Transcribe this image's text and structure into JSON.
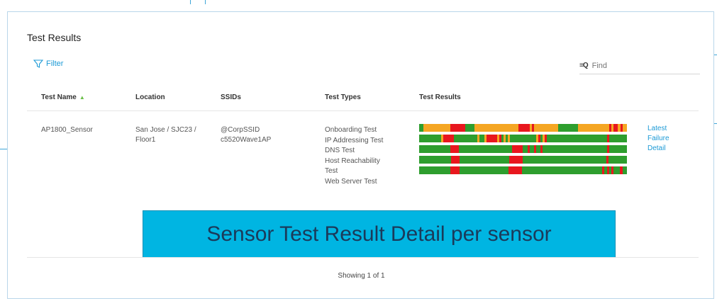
{
  "panel": {
    "title": "Test Results",
    "filter_label": "Filter",
    "find_placeholder": "Find"
  },
  "table": {
    "columns": [
      "Test Name",
      "Location",
      "SSIDs",
      "Test Types",
      "Test Results"
    ],
    "sort_column": "Test Name",
    "rows": [
      {
        "test_name": "AP1800_Sensor",
        "location_line1": "San Jose / SJC23 /",
        "location_line2": "Floor1",
        "ssid1": "@CorpSSID",
        "ssid2": "c5520Wave1AP",
        "test_types": [
          "Onboarding Test",
          "IP Addressing Test",
          "DNS Test",
          "Host Reachability",
          "Test",
          "Web Server Test"
        ],
        "link_lines": [
          "Latest",
          "Failure",
          "Detail"
        ],
        "result_bars": [
          [
            [
              "g",
              2
            ],
            [
              "o",
              12
            ],
            [
              "r",
              7
            ],
            [
              "g",
              4
            ],
            [
              "o",
              20
            ],
            [
              "r",
              5
            ],
            [
              "o",
              1
            ],
            [
              "r",
              1
            ],
            [
              "o",
              11
            ],
            [
              "g",
              9
            ],
            [
              "o",
              14
            ],
            [
              "r",
              1
            ],
            [
              "o",
              1
            ],
            [
              "r",
              2
            ],
            [
              "o",
              1
            ],
            [
              "r",
              1
            ],
            [
              "o",
              2
            ]
          ],
          [
            [
              "g",
              10
            ],
            [
              "o",
              1
            ],
            [
              "r",
              5
            ],
            [
              "g",
              11
            ],
            [
              "o",
              1
            ],
            [
              "g",
              2
            ],
            [
              "o",
              1
            ],
            [
              "r",
              5
            ],
            [
              "o",
              1
            ],
            [
              "r",
              1
            ],
            [
              "g",
              1
            ],
            [
              "o",
              1
            ],
            [
              "g",
              1
            ],
            [
              "o",
              1
            ],
            [
              "g",
              12
            ],
            [
              "o",
              1
            ],
            [
              "r",
              1
            ],
            [
              "g",
              1
            ],
            [
              "o",
              1
            ],
            [
              "r",
              1
            ],
            [
              "g",
              28
            ],
            [
              "r",
              1
            ],
            [
              "g",
              8
            ]
          ],
          [
            [
              "g",
              14
            ],
            [
              "r",
              4
            ],
            [
              "g",
              24
            ],
            [
              "r",
              5
            ],
            [
              "g",
              2
            ],
            [
              "r",
              1
            ],
            [
              "g",
              2
            ],
            [
              "r",
              1
            ],
            [
              "g",
              2
            ],
            [
              "r",
              1
            ],
            [
              "g",
              29
            ],
            [
              "r",
              1
            ],
            [
              "g",
              8
            ]
          ],
          [
            [
              "g",
              14
            ],
            [
              "r",
              4
            ],
            [
              "g",
              22
            ],
            [
              "r",
              6
            ],
            [
              "g",
              37
            ],
            [
              "r",
              1
            ],
            [
              "g",
              8
            ]
          ],
          [
            [
              "g",
              14
            ],
            [
              "r",
              4
            ],
            [
              "g",
              22
            ],
            [
              "r",
              6
            ],
            [
              "g",
              36
            ],
            [
              "r",
              1
            ],
            [
              "g",
              1
            ],
            [
              "r",
              1
            ],
            [
              "g",
              1
            ],
            [
              "r",
              1
            ],
            [
              "g",
              3
            ],
            [
              "r",
              1
            ],
            [
              "g",
              2
            ]
          ]
        ]
      }
    ]
  },
  "colors": {
    "g": "#2e9e2e",
    "o": "#f5a623",
    "r": "#e8171e",
    "accent": "#1c9ad6",
    "banner_bg": "#00b5e2"
  },
  "banner": {
    "text": "Sensor Test Result Detail per sensor"
  },
  "pagination": {
    "text": "Showing 1 of 1"
  }
}
